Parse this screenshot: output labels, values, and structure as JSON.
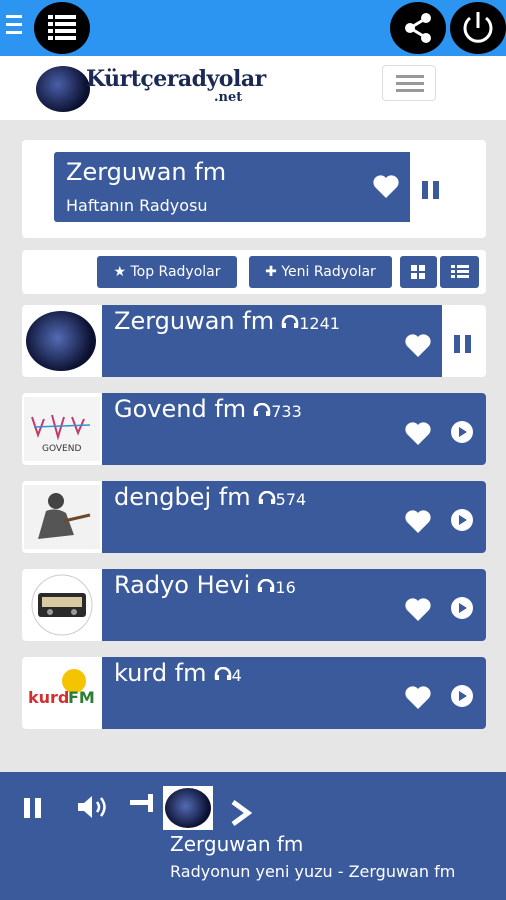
{
  "header": {
    "logo_main": "Kürtçeradyolar",
    "logo_net": ".net"
  },
  "featured": {
    "name": "Zerguwan fm",
    "subtitle": "Haftanın Radyosu"
  },
  "filters": {
    "top_label": "★ Top Radyolar",
    "new_label": "✚ Yeni Radyolar"
  },
  "stations": [
    {
      "name": "Zerguwan fm",
      "listeners": "1241",
      "state": "playing"
    },
    {
      "name": "Govend fm",
      "listeners": "733",
      "state": "stopped"
    },
    {
      "name": "dengbej fm",
      "listeners": "574",
      "state": "stopped"
    },
    {
      "name": "Radyo Hevi",
      "listeners": "16",
      "state": "stopped"
    },
    {
      "name": "kurd fm",
      "listeners": "4",
      "state": "stopped"
    }
  ],
  "player": {
    "name": "Zerguwan fm",
    "subtitle": "Radyonun yeni yuzu - Zerguwan fm"
  },
  "colors": {
    "topbar": "#2c95f2",
    "accent": "#3a5a9c",
    "background": "#e6e6e6"
  }
}
